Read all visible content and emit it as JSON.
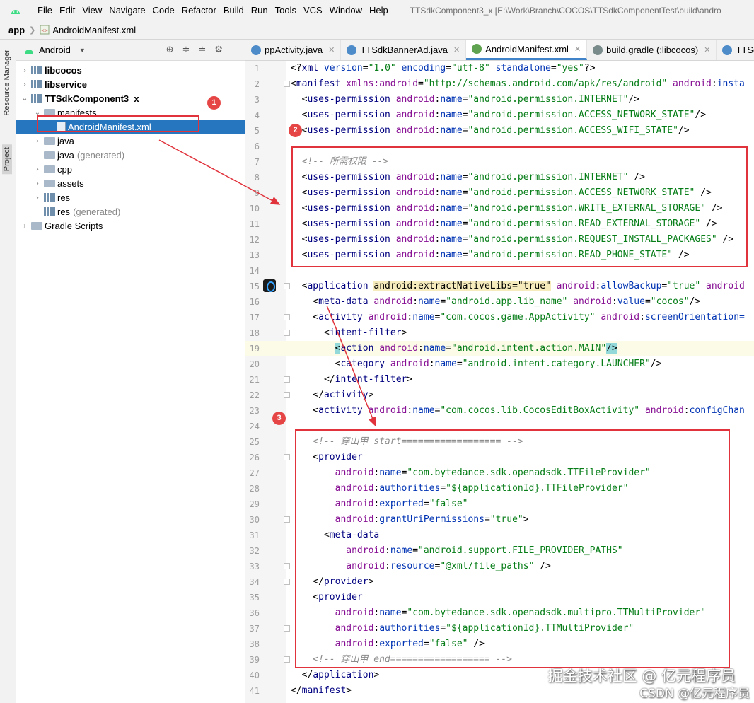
{
  "menubar": {
    "items": [
      "File",
      "Edit",
      "View",
      "Navigate",
      "Code",
      "Refactor",
      "Build",
      "Run",
      "Tools",
      "VCS",
      "Window",
      "Help"
    ],
    "window_title": "TTSdkComponent3_x [E:\\Work\\Branch\\COCOS\\TTSdkComponentTest\\build\\andro"
  },
  "breadcrumb": {
    "module": "app",
    "file": "AndroidManifest.xml"
  },
  "sidebar_tabs": {
    "resource_manager": "Resource Manager",
    "project": "Project"
  },
  "project_panel": {
    "view_selector": "Android",
    "tree": [
      {
        "label": "libcocos",
        "suffix": "",
        "bold": true,
        "arrow": "›",
        "icon": "module-icon",
        "indent": 0
      },
      {
        "label": "libservice",
        "suffix": "",
        "bold": true,
        "arrow": "›",
        "icon": "module-icon",
        "indent": 0
      },
      {
        "label": "TTSdkComponent3_x",
        "suffix": "",
        "bold": true,
        "arrow": "⌄",
        "icon": "module-icon",
        "indent": 0
      },
      {
        "label": "manifests",
        "suffix": "",
        "bold": false,
        "arrow": "⌄",
        "icon": "folder-icon",
        "indent": 1
      },
      {
        "label": "AndroidManifest.xml",
        "suffix": "",
        "bold": false,
        "arrow": "",
        "icon": "manifest-file-icon",
        "indent": 2,
        "selected": true
      },
      {
        "label": "java",
        "suffix": "",
        "bold": false,
        "arrow": "›",
        "icon": "folder-icon",
        "indent": 1
      },
      {
        "label": "java",
        "suffix": "(generated)",
        "bold": false,
        "arrow": "",
        "icon": "generated-folder-icon",
        "indent": 1
      },
      {
        "label": "cpp",
        "suffix": "",
        "bold": false,
        "arrow": "›",
        "icon": "folder-icon",
        "indent": 1
      },
      {
        "label": "assets",
        "suffix": "",
        "bold": false,
        "arrow": "›",
        "icon": "folder-icon",
        "indent": 1
      },
      {
        "label": "res",
        "suffix": "",
        "bold": false,
        "arrow": "›",
        "icon": "res-folder-icon",
        "indent": 1
      },
      {
        "label": "res",
        "suffix": "(generated)",
        "bold": false,
        "arrow": "",
        "icon": "res-folder-icon",
        "indent": 1
      },
      {
        "label": "Gradle Scripts",
        "suffix": "",
        "bold": false,
        "arrow": "›",
        "icon": "gradle-icon",
        "indent": 0
      }
    ]
  },
  "tabs": [
    {
      "label": "ppActivity.java",
      "icon_color": "#4d8bc9",
      "active": false
    },
    {
      "label": "TTSdkBannerAd.java",
      "icon_color": "#4d8bc9",
      "active": false
    },
    {
      "label": "AndroidManifest.xml",
      "icon_color": "#5fa24f",
      "active": true
    },
    {
      "label": "build.gradle (:libcocos)",
      "icon_color": "#7a8b8b",
      "active": false
    },
    {
      "label": "TTSdkSpla",
      "icon_color": "#4d8bc9",
      "active": false
    }
  ],
  "annotations": {
    "badge1": "1",
    "badge2": "2",
    "badge3": "3"
  },
  "code_lines": [
    [
      [
        "t-punct",
        "<?"
      ],
      [
        "t-tag",
        "xml "
      ],
      [
        "t-attr",
        "version"
      ],
      [
        "t-punct",
        "="
      ],
      [
        "t-str",
        "\"1.0\""
      ],
      [
        "t-attr",
        " encoding"
      ],
      [
        "t-punct",
        "="
      ],
      [
        "t-str",
        "\"utf-8\""
      ],
      [
        "t-attr",
        " standalone"
      ],
      [
        "t-punct",
        "="
      ],
      [
        "t-str",
        "\"yes\""
      ],
      [
        "t-punct",
        "?>"
      ]
    ],
    [
      [
        "t-punct",
        "<"
      ],
      [
        "t-tag",
        "manifest "
      ],
      [
        "t-ns",
        "xmlns:android"
      ],
      [
        "t-punct",
        "="
      ],
      [
        "t-str",
        "\"http://schemas.android.com/apk/res/android\""
      ],
      [
        "t-ns",
        " android"
      ],
      [
        "t-punct",
        ":"
      ],
      [
        "t-attr",
        "insta"
      ]
    ],
    [
      [
        "t-punct",
        "  <"
      ],
      [
        "t-tag",
        "uses-permission "
      ],
      [
        "t-ns",
        "android"
      ],
      [
        "t-punct",
        ":"
      ],
      [
        "t-attr",
        "name"
      ],
      [
        "t-punct",
        "="
      ],
      [
        "t-str",
        "\"android.permission.INTERNET\""
      ],
      [
        "t-punct",
        "/>"
      ]
    ],
    [
      [
        "t-punct",
        "  <"
      ],
      [
        "t-tag",
        "uses-permission "
      ],
      [
        "t-ns",
        "android"
      ],
      [
        "t-punct",
        ":"
      ],
      [
        "t-attr",
        "name"
      ],
      [
        "t-punct",
        "="
      ],
      [
        "t-str",
        "\"android.permission.ACCESS_NETWORK_STATE\""
      ],
      [
        "t-punct",
        "/>"
      ]
    ],
    [
      [
        "t-punct",
        "  <"
      ],
      [
        "t-tag",
        "uses-permission "
      ],
      [
        "t-ns",
        "android"
      ],
      [
        "t-punct",
        ":"
      ],
      [
        "t-attr",
        "name"
      ],
      [
        "t-punct",
        "="
      ],
      [
        "t-str",
        "\"android.permission.ACCESS_WIFI_STATE\""
      ],
      [
        "t-punct",
        "/>"
      ]
    ],
    [],
    [
      [
        "t-cmt",
        "  <!-- 所需权限 -->"
      ]
    ],
    [
      [
        "t-punct",
        "  <"
      ],
      [
        "t-tag",
        "uses-permission "
      ],
      [
        "t-ns",
        "android"
      ],
      [
        "t-punct",
        ":"
      ],
      [
        "t-attr",
        "name"
      ],
      [
        "t-punct",
        "="
      ],
      [
        "t-str",
        "\"android.permission.INTERNET\""
      ],
      [
        "t-punct",
        " />"
      ]
    ],
    [
      [
        "t-punct",
        "  <"
      ],
      [
        "t-tag",
        "uses-permission "
      ],
      [
        "t-ns",
        "android"
      ],
      [
        "t-punct",
        ":"
      ],
      [
        "t-attr",
        "name"
      ],
      [
        "t-punct",
        "="
      ],
      [
        "t-str",
        "\"android.permission.ACCESS_NETWORK_STATE\""
      ],
      [
        "t-punct",
        " />"
      ]
    ],
    [
      [
        "t-punct",
        "  <"
      ],
      [
        "t-tag",
        "uses-permission "
      ],
      [
        "t-ns",
        "android"
      ],
      [
        "t-punct",
        ":"
      ],
      [
        "t-attr",
        "name"
      ],
      [
        "t-punct",
        "="
      ],
      [
        "t-str",
        "\"android.permission.WRITE_EXTERNAL_STORAGE\""
      ],
      [
        "t-punct",
        " />"
      ]
    ],
    [
      [
        "t-punct",
        "  <"
      ],
      [
        "t-tag",
        "uses-permission "
      ],
      [
        "t-ns",
        "android"
      ],
      [
        "t-punct",
        ":"
      ],
      [
        "t-attr",
        "name"
      ],
      [
        "t-punct",
        "="
      ],
      [
        "t-str",
        "\"android.permission.READ_EXTERNAL_STORAGE\""
      ],
      [
        "t-punct",
        " />"
      ]
    ],
    [
      [
        "t-punct",
        "  <"
      ],
      [
        "t-tag",
        "uses-permission "
      ],
      [
        "t-ns",
        "android"
      ],
      [
        "t-punct",
        ":"
      ],
      [
        "t-attr",
        "name"
      ],
      [
        "t-punct",
        "="
      ],
      [
        "t-str",
        "\"android.permission.REQUEST_INSTALL_PACKAGES\""
      ],
      [
        "t-punct",
        " />"
      ]
    ],
    [
      [
        "t-punct",
        "  <"
      ],
      [
        "t-tag",
        "uses-permission "
      ],
      [
        "t-ns",
        "android"
      ],
      [
        "t-punct",
        ":"
      ],
      [
        "t-attr",
        "name"
      ],
      [
        "t-punct",
        "="
      ],
      [
        "t-str",
        "\"android.permission.READ_PHONE_STATE\""
      ],
      [
        "t-punct",
        " />"
      ]
    ],
    [],
    [
      [
        "t-punct",
        "  <"
      ],
      [
        "t-tag",
        "application "
      ],
      [
        "t-hlattr",
        "android:extractNativeLibs=\"true\""
      ],
      [
        "t-ns",
        " android"
      ],
      [
        "t-punct",
        ":"
      ],
      [
        "t-attr",
        "allowBackup"
      ],
      [
        "t-punct",
        "="
      ],
      [
        "t-str",
        "\"true\""
      ],
      [
        "t-ns",
        " android"
      ]
    ],
    [
      [
        "t-punct",
        "    <"
      ],
      [
        "t-tag",
        "meta-data "
      ],
      [
        "t-ns",
        "android"
      ],
      [
        "t-punct",
        ":"
      ],
      [
        "t-attr",
        "name"
      ],
      [
        "t-punct",
        "="
      ],
      [
        "t-str",
        "\"android.app.lib_name\""
      ],
      [
        "t-ns",
        " android"
      ],
      [
        "t-punct",
        ":"
      ],
      [
        "t-attr",
        "value"
      ],
      [
        "t-punct",
        "="
      ],
      [
        "t-str",
        "\"cocos\""
      ],
      [
        "t-punct",
        "/>"
      ]
    ],
    [
      [
        "t-punct",
        "    <"
      ],
      [
        "t-tag",
        "activity "
      ],
      [
        "t-ns",
        "android"
      ],
      [
        "t-punct",
        ":"
      ],
      [
        "t-attr",
        "name"
      ],
      [
        "t-punct",
        "="
      ],
      [
        "t-str",
        "\"com.cocos.game.AppActivity\""
      ],
      [
        "t-ns",
        " android"
      ],
      [
        "t-punct",
        ":"
      ],
      [
        "t-attr",
        "screenOrientation="
      ]
    ],
    [
      [
        "t-punct",
        "      <"
      ],
      [
        "t-tag",
        "intent-filter"
      ],
      [
        "t-punct",
        ">"
      ]
    ],
    [
      [
        "t-punct",
        "        "
      ],
      [
        "t-hltag",
        "<"
      ],
      [
        "t-tag",
        "action "
      ],
      [
        "t-ns",
        "android"
      ],
      [
        "t-punct",
        ":"
      ],
      [
        "t-attr",
        "name"
      ],
      [
        "t-punct",
        "="
      ],
      [
        "t-str",
        "\"android.intent.action.MAIN\""
      ],
      [
        "t-hltag",
        "/>"
      ]
    ],
    [
      [
        "t-punct",
        "        <"
      ],
      [
        "t-tag",
        "category "
      ],
      [
        "t-ns",
        "android"
      ],
      [
        "t-punct",
        ":"
      ],
      [
        "t-attr",
        "name"
      ],
      [
        "t-punct",
        "="
      ],
      [
        "t-str",
        "\"android.intent.category.LAUNCHER\""
      ],
      [
        "t-punct",
        "/>"
      ]
    ],
    [
      [
        "t-punct",
        "      </"
      ],
      [
        "t-tag",
        "intent-filter"
      ],
      [
        "t-punct",
        ">"
      ]
    ],
    [
      [
        "t-punct",
        "    </"
      ],
      [
        "t-tag",
        "activity"
      ],
      [
        "t-punct",
        ">"
      ]
    ],
    [
      [
        "t-punct",
        "    <"
      ],
      [
        "t-tag",
        "activity "
      ],
      [
        "t-ns",
        "android"
      ],
      [
        "t-punct",
        ":"
      ],
      [
        "t-attr",
        "name"
      ],
      [
        "t-punct",
        "="
      ],
      [
        "t-str",
        "\"com.cocos.lib.CocosEditBoxActivity\""
      ],
      [
        "t-ns",
        " android"
      ],
      [
        "t-punct",
        ":"
      ],
      [
        "t-attr",
        "configChan"
      ]
    ],
    [],
    [
      [
        "t-cmt",
        "    <!-- 穿山甲 start================== -->"
      ]
    ],
    [
      [
        "t-punct",
        "    <"
      ],
      [
        "t-tag",
        "provider"
      ]
    ],
    [
      [
        "t-ns",
        "        android"
      ],
      [
        "t-punct",
        ":"
      ],
      [
        "t-attr",
        "name"
      ],
      [
        "t-punct",
        "="
      ],
      [
        "t-str",
        "\"com.bytedance.sdk.openadsdk.TTFileProvider\""
      ]
    ],
    [
      [
        "t-ns",
        "        android"
      ],
      [
        "t-punct",
        ":"
      ],
      [
        "t-attr",
        "authorities"
      ],
      [
        "t-punct",
        "="
      ],
      [
        "t-str",
        "\"${applicationId}.TTFileProvider\""
      ]
    ],
    [
      [
        "t-ns",
        "        android"
      ],
      [
        "t-punct",
        ":"
      ],
      [
        "t-attr",
        "exported"
      ],
      [
        "t-punct",
        "="
      ],
      [
        "t-str",
        "\"false\""
      ]
    ],
    [
      [
        "t-ns",
        "        android"
      ],
      [
        "t-punct",
        ":"
      ],
      [
        "t-attr",
        "grantUriPermissions"
      ],
      [
        "t-punct",
        "="
      ],
      [
        "t-str",
        "\"true\""
      ],
      [
        "t-punct",
        ">"
      ]
    ],
    [
      [
        "t-punct",
        "      <"
      ],
      [
        "t-tag",
        "meta-data"
      ]
    ],
    [
      [
        "t-ns",
        "          android"
      ],
      [
        "t-punct",
        ":"
      ],
      [
        "t-attr",
        "name"
      ],
      [
        "t-punct",
        "="
      ],
      [
        "t-str",
        "\"android.support.FILE_PROVIDER_PATHS\""
      ]
    ],
    [
      [
        "t-ns",
        "          android"
      ],
      [
        "t-punct",
        ":"
      ],
      [
        "t-attr",
        "resource"
      ],
      [
        "t-punct",
        "="
      ],
      [
        "t-str",
        "\"@xml/file_paths\""
      ],
      [
        "t-punct",
        " />"
      ]
    ],
    [
      [
        "t-punct",
        "    </"
      ],
      [
        "t-tag",
        "provider"
      ],
      [
        "t-punct",
        ">"
      ]
    ],
    [
      [
        "t-punct",
        "    <"
      ],
      [
        "t-tag",
        "provider"
      ]
    ],
    [
      [
        "t-ns",
        "        android"
      ],
      [
        "t-punct",
        ":"
      ],
      [
        "t-attr",
        "name"
      ],
      [
        "t-punct",
        "="
      ],
      [
        "t-str",
        "\"com.bytedance.sdk.openadsdk.multipro.TTMultiProvider\""
      ]
    ],
    [
      [
        "t-ns",
        "        android"
      ],
      [
        "t-punct",
        ":"
      ],
      [
        "t-attr",
        "authorities"
      ],
      [
        "t-punct",
        "="
      ],
      [
        "t-str",
        "\"${applicationId}.TTMultiProvider\""
      ]
    ],
    [
      [
        "t-ns",
        "        android"
      ],
      [
        "t-punct",
        ":"
      ],
      [
        "t-attr",
        "exported"
      ],
      [
        "t-punct",
        "="
      ],
      [
        "t-str",
        "\"false\""
      ],
      [
        "t-punct",
        " />"
      ]
    ],
    [
      [
        "t-cmt",
        "    <!-- 穿山甲 end================== -->"
      ]
    ],
    [
      [
        "t-punct",
        "  </"
      ],
      [
        "t-tag",
        "application"
      ],
      [
        "t-punct",
        ">"
      ]
    ],
    [
      [
        "t-punct",
        "</"
      ],
      [
        "t-tag",
        "manifest"
      ],
      [
        "t-punct",
        ">"
      ]
    ]
  ],
  "watermark": {
    "line1": "掘金技术社区 @ 亿元程序员",
    "line2": "CSDN @亿元程序员"
  }
}
